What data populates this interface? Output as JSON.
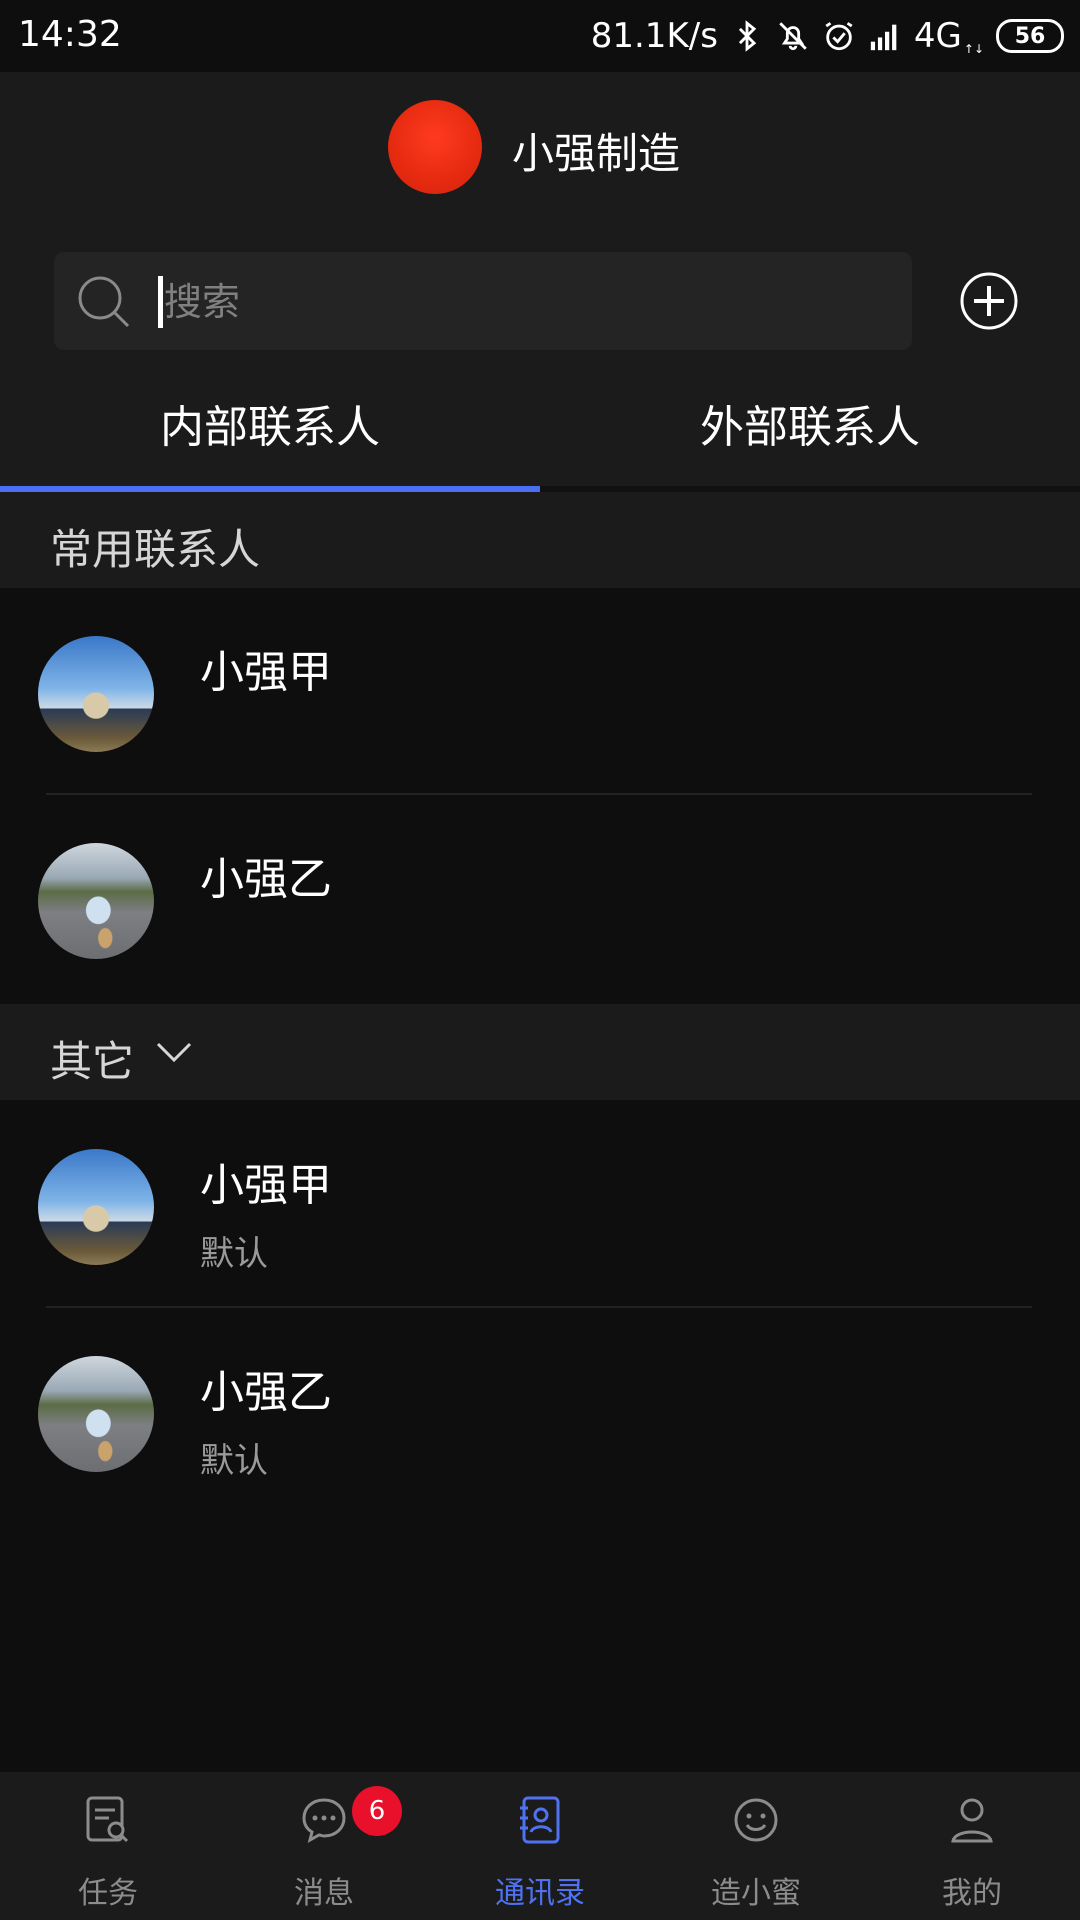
{
  "status_bar": {
    "time": "14:32",
    "network_speed": "81.1K/s",
    "network_type": "4G",
    "network_arrows": "↑↓",
    "battery": "56",
    "icons": [
      "bluetooth-icon",
      "bell-muted-icon",
      "alarm-icon",
      "signal-icon"
    ]
  },
  "header": {
    "org_name": "小强制造",
    "logo_color": "#e52a10"
  },
  "search": {
    "placeholder": "搜索",
    "value": ""
  },
  "tabs": [
    {
      "label": "内部联系人",
      "active": true
    },
    {
      "label": "外部联系人",
      "active": false
    }
  ],
  "sections": [
    {
      "title": "常用联系人",
      "contacts": [
        {
          "name": "小强甲",
          "subtitle": ""
        },
        {
          "name": "小强乙",
          "subtitle": ""
        }
      ]
    },
    {
      "title": "其它",
      "expanded": true,
      "contacts": [
        {
          "name": "小强甲",
          "subtitle": "默认"
        },
        {
          "name": "小强乙",
          "subtitle": "默认"
        }
      ]
    }
  ],
  "bottom_nav": [
    {
      "label": "任务",
      "icon": "task-icon",
      "active": false
    },
    {
      "label": "消息",
      "icon": "message-icon",
      "active": false,
      "badge": "6"
    },
    {
      "label": "通讯录",
      "icon": "contacts-icon",
      "active": true
    },
    {
      "label": "造小蜜",
      "icon": "assistant-icon",
      "active": false
    },
    {
      "label": "我的",
      "icon": "profile-icon",
      "active": false
    }
  ],
  "colors": {
    "accent": "#4f73f0",
    "badge": "#e8102a",
    "background": "#0e0e0f",
    "header_background": "#1b1b1c"
  }
}
